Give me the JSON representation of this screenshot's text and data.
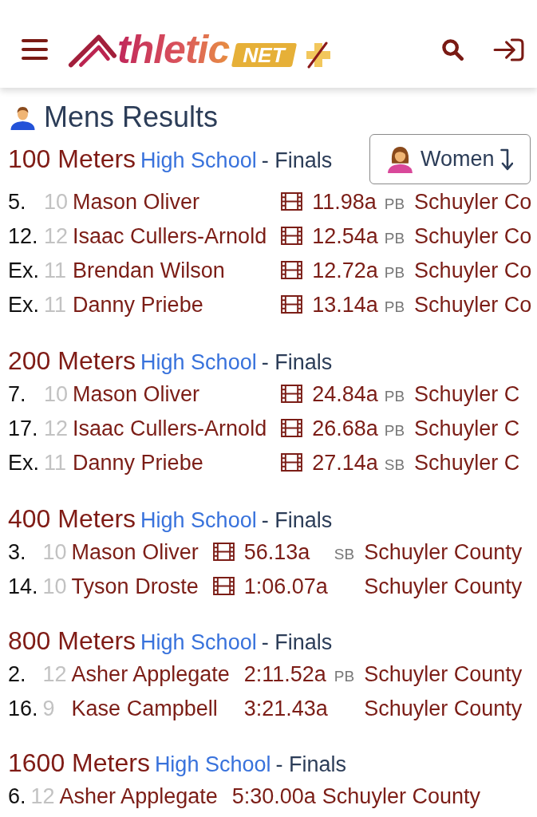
{
  "header": {
    "logo": {
      "text": "thletic",
      "badge": "NET"
    }
  },
  "page_title": "Mens Results",
  "gender_toggle": {
    "label": "Women"
  },
  "events": [
    {
      "name": "100 Meters",
      "division": "High School",
      "round": "- Finals",
      "results": [
        {
          "place": "5.",
          "grade": "10",
          "name": "Mason Oliver",
          "video": true,
          "time": "11.98a",
          "badge": "PB",
          "team": "Schuyler Co"
        },
        {
          "place": "12.",
          "grade": "12",
          "name": "Isaac Cullers-Arnold",
          "video": true,
          "time": "12.54a",
          "badge": "PB",
          "team": "Schuyler Co"
        },
        {
          "place": "Ex.",
          "grade": "11",
          "name": "Brendan Wilson",
          "video": true,
          "time": "12.72a",
          "badge": "PB",
          "team": "Schuyler Co"
        },
        {
          "place": "Ex.",
          "grade": "11",
          "name": "Danny Priebe",
          "video": true,
          "time": "13.14a",
          "badge": "PB",
          "team": "Schuyler Co"
        }
      ]
    },
    {
      "name": "200 Meters",
      "division": "High School",
      "round": "- Finals",
      "results": [
        {
          "place": "7.",
          "grade": "10",
          "name": "Mason Oliver",
          "video": true,
          "time": "24.84a",
          "badge": "PB",
          "team": "Schuyler C"
        },
        {
          "place": "17.",
          "grade": "12",
          "name": "Isaac Cullers-Arnold",
          "video": true,
          "time": "26.68a",
          "badge": "PB",
          "team": "Schuyler C"
        },
        {
          "place": "Ex.",
          "grade": "11",
          "name": "Danny Priebe",
          "video": true,
          "time": "27.14a",
          "badge": "SB",
          "team": "Schuyler C"
        }
      ]
    },
    {
      "name": "400 Meters",
      "division": "High School",
      "round": "- Finals",
      "results": [
        {
          "place": "3.",
          "grade": "10",
          "name": "Mason Oliver",
          "video": true,
          "time": "56.13a",
          "badge": "SB",
          "team": "Schuyler County"
        },
        {
          "place": "14.",
          "grade": "10",
          "name": "Tyson Droste",
          "video": true,
          "time": "1:06.07a",
          "team": "Schuyler County"
        }
      ]
    },
    {
      "name": "800 Meters",
      "division": "High School",
      "round": "- Finals",
      "results": [
        {
          "place": "2.",
          "grade": "12",
          "name": "Asher Applegate",
          "video": false,
          "time": "2:11.52a",
          "badge": "PB",
          "team": "Schuyler County"
        },
        {
          "place": "16.",
          "grade": "9",
          "name": "Kase Campbell",
          "video": false,
          "time": "3:21.43a",
          "team": "Schuyler County"
        }
      ]
    },
    {
      "name": "1600 Meters",
      "division": "High School",
      "round": "- Finals",
      "results": [
        {
          "place": "6.",
          "grade": "12",
          "name": "Asher Applegate",
          "video": false,
          "time": "5:30.00a",
          "team": "Schuyler County"
        }
      ]
    }
  ]
}
